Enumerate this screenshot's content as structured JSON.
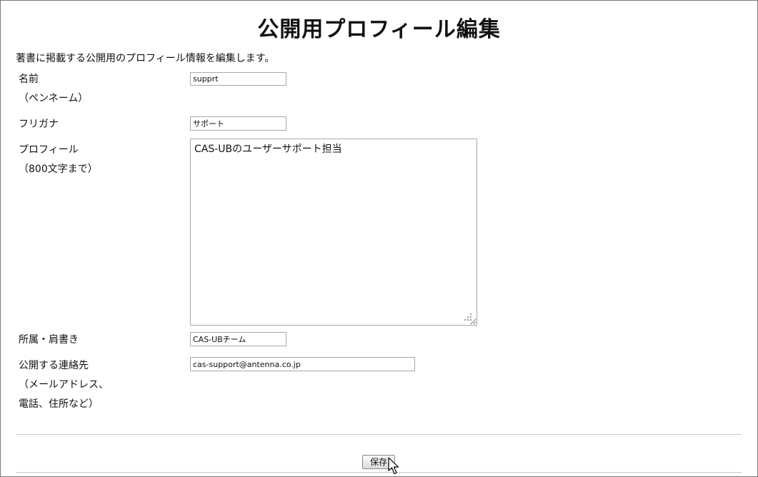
{
  "page": {
    "title": "公開用プロフィール編集",
    "description": "著書に掲載する公開用のプロフィール情報を編集します。"
  },
  "form": {
    "name": {
      "label_line1": "名前",
      "label_line2": "（ペンネーム）",
      "value": "supprt"
    },
    "furigana": {
      "label_line1": "フリガナ",
      "value": "サポート"
    },
    "profile": {
      "label_line1": "プロフィール",
      "label_line2": "（800文字まで）",
      "value": "CAS-UBのユーザーサポート担当"
    },
    "affiliation": {
      "label_line1": "所属・肩書き",
      "value": "CAS-UBチーム"
    },
    "contact": {
      "label_line1": "公開する連絡先",
      "label_line2": "（メールアドレス、",
      "label_line3": "電話、住所など）",
      "value": "cas-support@antenna.co.jp"
    }
  },
  "actions": {
    "save_label": "保存"
  },
  "icons": {
    "cursor": "arrow-cursor-icon",
    "resize": "resize-grip-icon"
  }
}
